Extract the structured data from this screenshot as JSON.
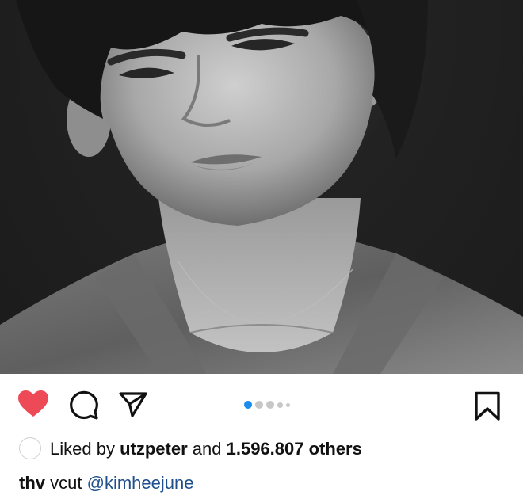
{
  "post": {
    "image_description_icon": "portrait-photo",
    "carousel": {
      "count": 5,
      "active_index": 0
    }
  },
  "actions": {
    "like_icon": "heart-filled-icon",
    "comment_icon": "comment-bubble-icon",
    "share_icon": "paper-plane-icon",
    "save_icon": "bookmark-icon",
    "like_color": "#ed4956"
  },
  "likes": {
    "prefix": "Liked by",
    "user": "utzpeter",
    "middle": "and",
    "count": "1.596.807 others"
  },
  "caption": {
    "username": "thv",
    "text": "vcut",
    "mention": "@kimheejune"
  }
}
